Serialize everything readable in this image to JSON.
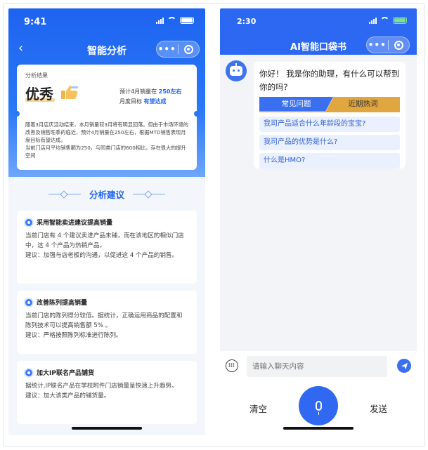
{
  "left": {
    "status": {
      "time": "9:41"
    },
    "nav": {
      "title": "智能分析",
      "back": "‹",
      "more": "•••"
    },
    "result": {
      "label": "分析结果",
      "grade": "优秀",
      "pred_prefix": "预计4月销量在",
      "pred_value": "250左右",
      "target_prefix": "月度目标",
      "target_value": "有望达成",
      "desc": "随着3月店庆活动结束，本月销量较3月将有明显回落。但由于市场环境的改善及销售旺季的临近，预计4月销量在250左右，根据MTD销售表现月度目标有望达成。\n当前门店月平均销售额为250，与同类门店的600相比，存在很大的提升空间"
    },
    "advice": {
      "title": "分析建议",
      "items": [
        {
          "title": "采用智能卖进建议提高销量",
          "body": "当前门店有 4 个建议卖进产品未铺，而在该地区的相似门店中，这 4 个产品为热销产品。\n建议：加强与店老板的沟通，以促进这 4 个产品的销售。"
        },
        {
          "title": "改善陈列提高销量",
          "body": "当前门店的陈列得分较低。据统计，正确运用商品的配置和陈列技术可以提高销售额 5% 。\n建议：严格按照陈列标准进行陈列。"
        },
        {
          "title": "加大IP联名产品铺货",
          "body": "据统计,IP联名产品在学校附件门店销量呈快速上升趋势。\n建议：加大该类产品的铺货量。"
        }
      ]
    }
  },
  "right": {
    "status": {
      "time": "2:30"
    },
    "nav": {
      "title": "AI智能口袋书",
      "more": "•••"
    },
    "greeting": "你好！ 我是你的助理，有什么可以帮到你的吗?",
    "tabs": [
      "常见问题",
      "近期热词"
    ],
    "questions": [
      "我司产品适合什么年龄段的宝宝?",
      "我司产品的优势是什么?",
      "什么是HMO?"
    ],
    "input": {
      "placeholder": "请输入聊天内容"
    },
    "buttons": {
      "clear": "清空",
      "send": "发送"
    }
  }
}
